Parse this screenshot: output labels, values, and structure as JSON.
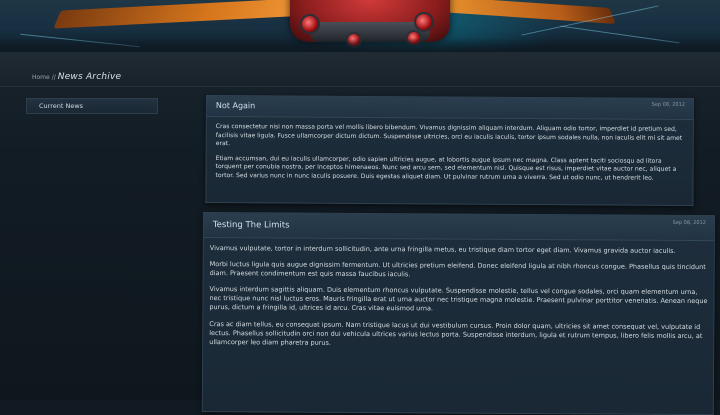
{
  "breadcrumb": {
    "home": "Home",
    "separator": "//",
    "current": "News Archive"
  },
  "sidebar": {
    "items": [
      {
        "label": "Current News"
      }
    ]
  },
  "articles": [
    {
      "title": "Not Again",
      "date": "Sep 08, 2012",
      "paragraphs": [
        "Cras consectetur nisi non massa porta vel mollis libero bibendum. Vivamus dignissim aliquam interdum. Aliquam odio tortor, imperdiet id pretium sed, facilisis vitae ligula. Fusce ullamcorper dictum dictum. Suspendisse ultricies, orci eu iaculis iaculis, tortor ipsum sodales nulla, non iaculis elit mi sit amet erat.",
        "Etiam accumsan, dui eu iaculis ullamcorper, odio sapien ultricies augue, at lobortis augue ipsum nec magna. Class aptent taciti sociosqu ad litora torquent per conubia nostra, per inceptos himenaeos. Nunc sed arcu sem, sed elementum nisl. Quisque est risus, imperdiet vitae auctor nec, aliquet a tortor. Sed varius nunc in nunc iaculis posuere. Duis egestas aliquet diam. Ut pulvinar rutrum urna a viverra. Sed ut odio nunc, ut hendrerit leo."
      ]
    },
    {
      "title": "Testing The Limits",
      "date": "Sep 08, 2012",
      "paragraphs": [
        "Vivamus vulputate, tortor in interdum sollicitudin, ante urna fringilla metus, eu tristique diam tortor eget diam. Vivamus gravida auctor iaculis.",
        "Morbi luctus ligula quis augue dignissim fermentum. Ut ultricies pretium eleifend. Donec eleifend ligula at nibh rhoncus congue. Phasellus quis tincidunt diam. Praesent condimentum est quis massa faucibus iaculis.",
        "Vivamus interdum sagittis aliquam. Duis elementum rhoncus vulputate. Suspendisse molestie, tellus vel congue sodales, orci quam elementum urna, nec tristique nunc nisl luctus eros. Mauris fringilla erat ut urna auctor nec tristique magna molestie. Praesent pulvinar porttitor venenatis. Aenean neque purus, dictum a fringilla id, ultrices id arcu. Cras vitae euismod urna.",
        "Cras ac diam tellus, eu consequat ipsum. Nam tristique lacus ut dui vestibulum cursus. Proin dolor quam, ultricies sit amet consequat vel, vulputate id lectus. Phasellus sollicitudin orci non dui vehicula ultrices varius lectus porta. Suspendisse interdum, ligula et rutrum tempus, libero felis mollis arcu, at ullamcorper leo diam pharetra purus."
      ]
    }
  ]
}
